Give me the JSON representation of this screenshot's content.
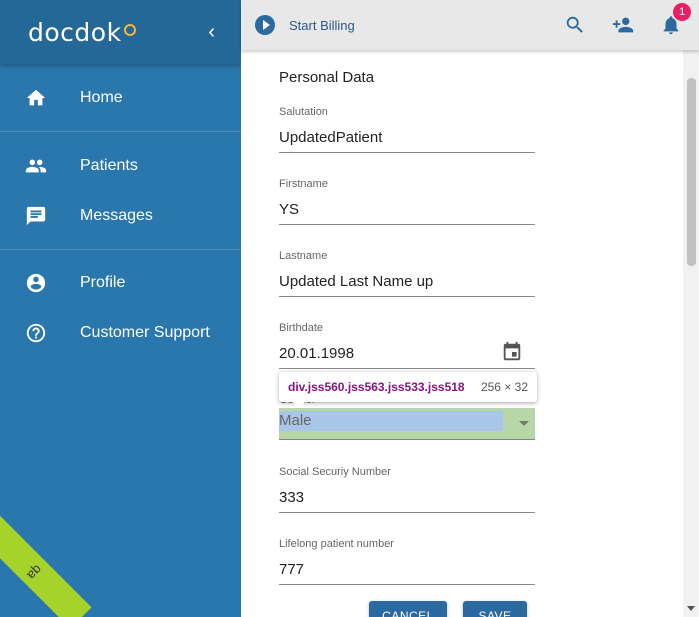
{
  "sidebar": {
    "logo": "docdok",
    "items": [
      {
        "label": "Home"
      },
      {
        "label": "Patients"
      },
      {
        "label": "Messages"
      },
      {
        "label": "Profile"
      },
      {
        "label": "Customer Support"
      }
    ],
    "env_badge": "qa"
  },
  "topbar": {
    "start_billing": "Start Billing",
    "notification_count": "1"
  },
  "form": {
    "section_title": "Personal Data",
    "salutation": {
      "label": "Salutation",
      "value": "UpdatedPatient"
    },
    "firstname": {
      "label": "Firstname",
      "value": "YS"
    },
    "lastname": {
      "label": "Lastname",
      "value": "Updated Last Name up"
    },
    "birthdate": {
      "label": "Birthdate",
      "value": "20.01.1998"
    },
    "gender": {
      "label": "Gender",
      "value": "Male"
    },
    "ssn": {
      "label": "Social Securiy Number",
      "value": "333"
    },
    "lifelong": {
      "label": "Lifelong patient number",
      "value": "777"
    },
    "cancel_label": "CANCEL",
    "save_label": "SAVE"
  },
  "devtools_tooltip": {
    "selector": "div.jss560.jss563.jss533.jss518",
    "dimensions": "256 × 32"
  }
}
